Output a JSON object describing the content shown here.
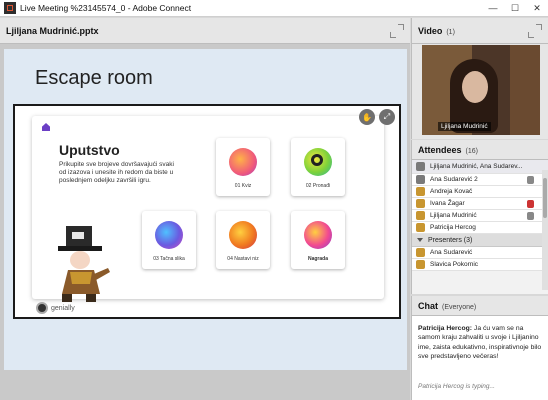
{
  "window": {
    "title": "Live Meeting %23145574_0 - Adobe Connect",
    "minimize": "—",
    "maximize": "☐",
    "close": "✕"
  },
  "share": {
    "file": "Ljiljana Mudrinić.pptx",
    "slide_title": "Escape room",
    "card": {
      "heading": "Uputstvo",
      "text": "Prikupite sve brojeve dovršavajući svaki od izazova i unesite ih redom da biste u poslednjem odeljku završili igru.",
      "tiles": [
        {
          "label": "01 Kviz",
          "color": "#f05a7a"
        },
        {
          "label": "02 Pronađi",
          "color": "#7dd23a"
        },
        {
          "label": "03 Tačna slika",
          "color": "#6a5ae0"
        },
        {
          "label": "04 Nastavi niz",
          "color": "#f07a20"
        },
        {
          "label": "Nagrada",
          "color": "#e13da0"
        }
      ],
      "logo": "genially"
    }
  },
  "video": {
    "title": "Video",
    "count": "(1)",
    "name": "Ljiljana Mudrinić"
  },
  "attendees": {
    "title": "Attendees",
    "count": "(16)",
    "header_row": "Ljiljana Mudrinić, Ana Sudarev...",
    "list": [
      "Ana Sudarević 2",
      "Andreja Kovač",
      "Ivana Žagar",
      "Ljiljana Mudrinić",
      "Patricija Hercog"
    ],
    "presenters_label": "Presenters (3)",
    "presenters": [
      "Ana Sudarević",
      "Slavica Pokornic"
    ]
  },
  "chat": {
    "title": "Chat",
    "scope": "(Everyone)",
    "author": "Patricija Hercog:",
    "message": " Ja ću vam se na samom kraju zahvaliti u svoje i Ljiljanino ime, zaista edukativno, inspirativnoje bilo sve predstavljeno večeras!",
    "typing": "Patricija Hercog is typing..."
  }
}
